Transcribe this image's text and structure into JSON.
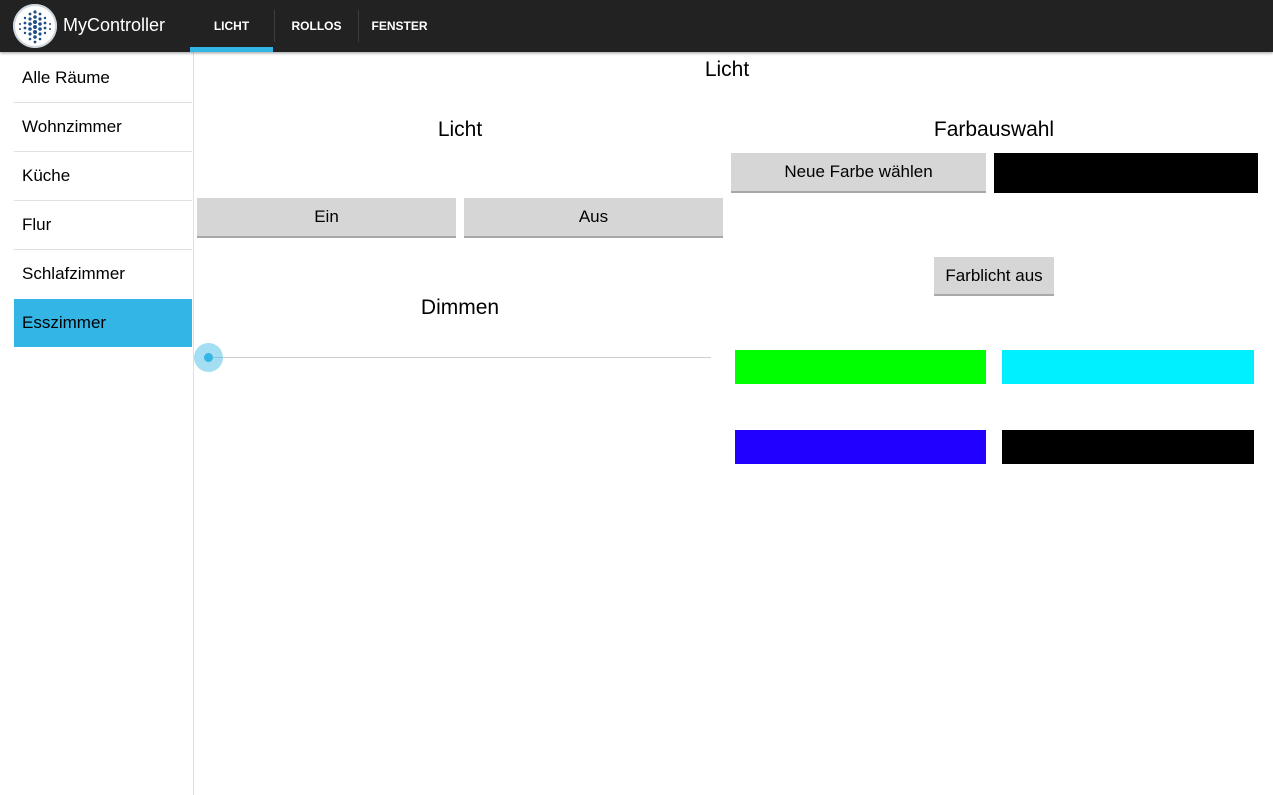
{
  "app": {
    "title": "MyController",
    "logo_icon": "mycontroller-logo-icon"
  },
  "tabs": [
    {
      "label": "LICHT",
      "active": true
    },
    {
      "label": "ROLLOS",
      "active": false
    },
    {
      "label": "FENSTER",
      "active": false
    }
  ],
  "sidebar": {
    "items": [
      {
        "label": "Alle Räume"
      },
      {
        "label": "Wohnzimmer"
      },
      {
        "label": "Küche"
      },
      {
        "label": "Flur"
      },
      {
        "label": "Schlafzimmer"
      },
      {
        "label": "Esszimmer",
        "selected": true
      }
    ]
  },
  "main": {
    "title": "Licht",
    "light_section": {
      "heading": "Licht",
      "on_label": "Ein",
      "off_label": "Aus",
      "dim_heading": "Dimmen",
      "dim_level_percent": 0
    },
    "color_section": {
      "heading": "Farbauswahl",
      "choose_label": "Neue Farbe wählen",
      "current_color": "#000000",
      "off_label": "Farblicht aus",
      "presets": [
        "#00ff00",
        "#00f0ff",
        "#2200ff",
        "#000000"
      ]
    }
  },
  "colors": {
    "accent": "#33b5e5",
    "actionbar": "#222222",
    "button": "#d6d6d6"
  }
}
